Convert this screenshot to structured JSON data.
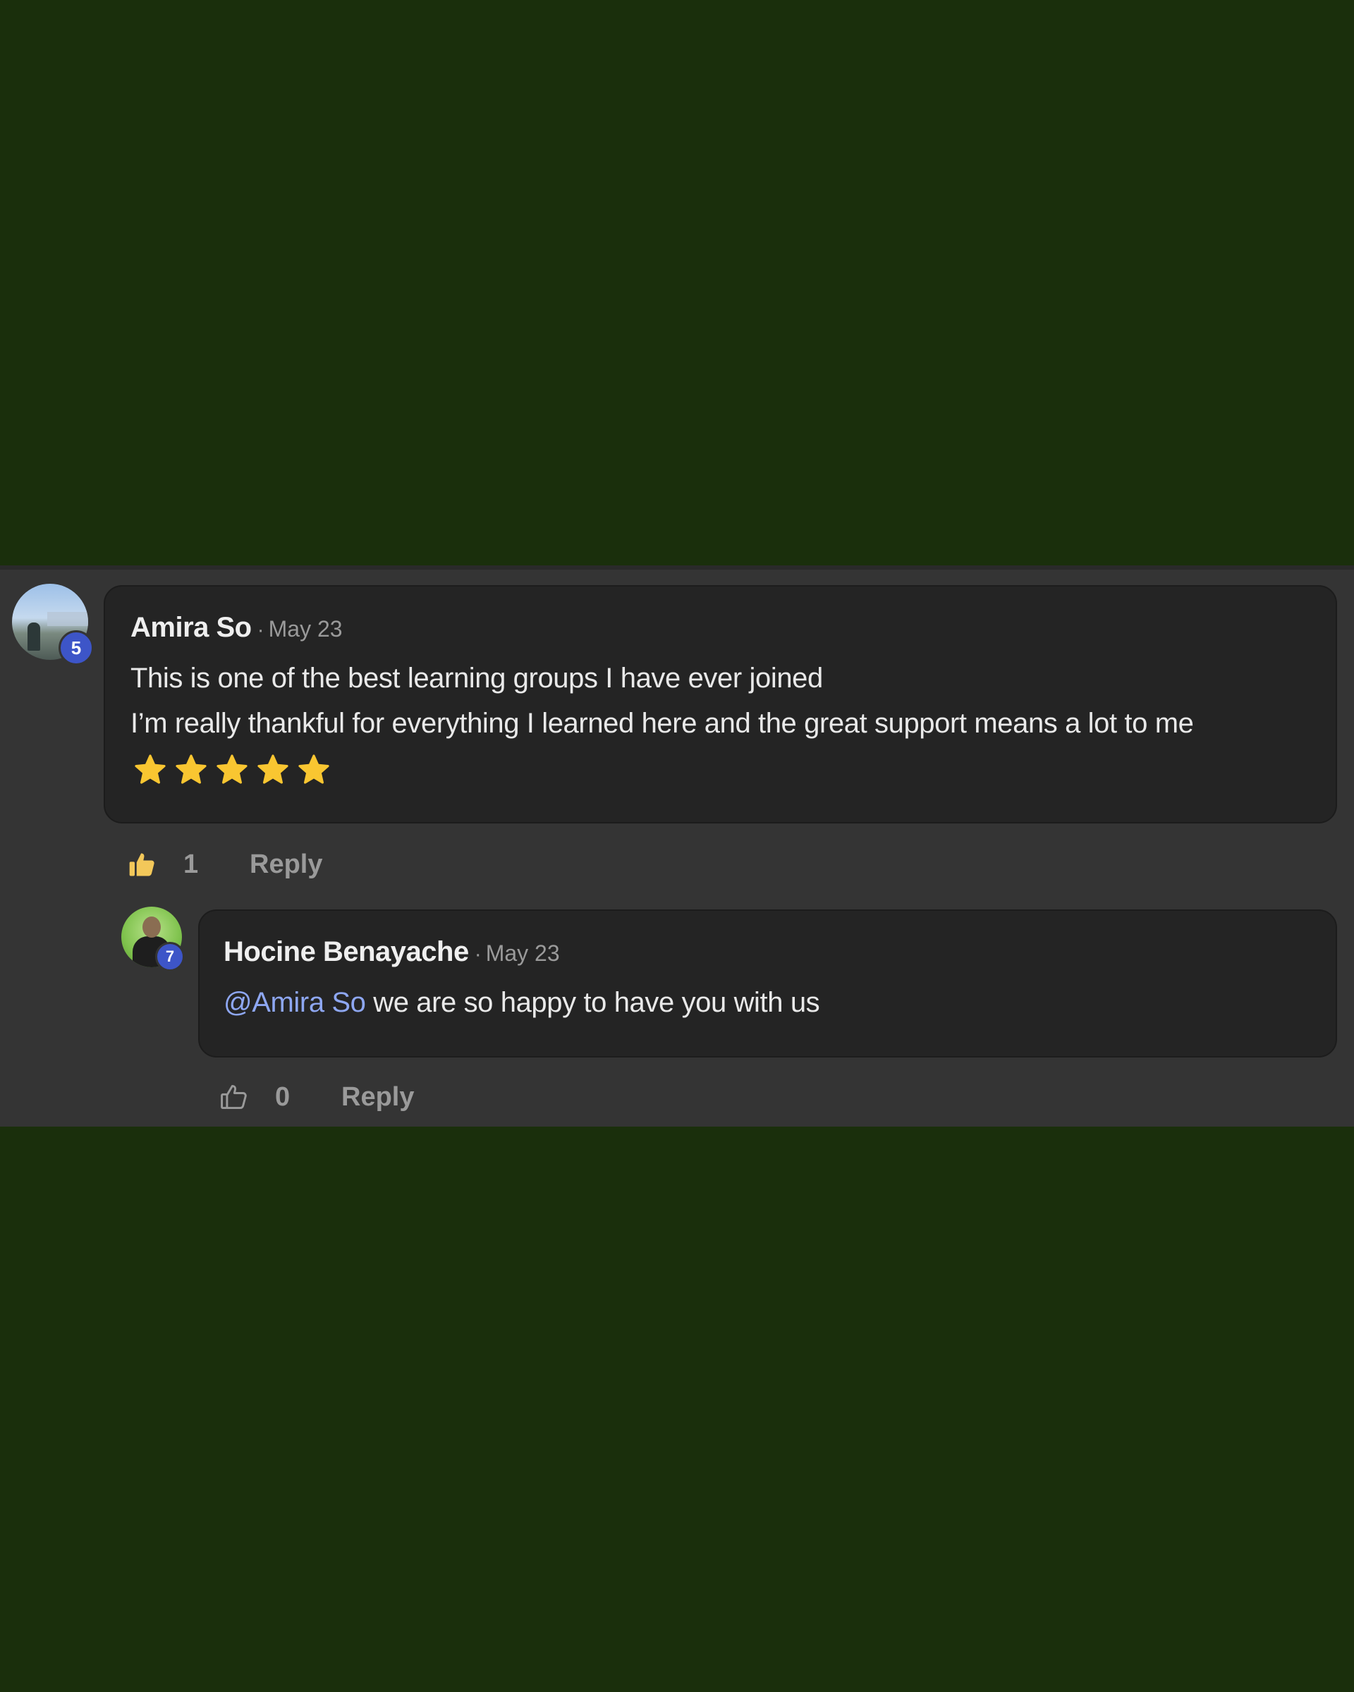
{
  "colors": {
    "page_background": "#1a2f0c",
    "panel_background": "#343434",
    "bubble_background": "#242424",
    "level_badge": "#3d55c8",
    "mention": "#8ea7f2",
    "star": "#f9c631",
    "liked_icon": "#f3c85a"
  },
  "comment": {
    "author": "Amira So",
    "separator": "·",
    "date": "May 23",
    "avatar_level": "5",
    "text_lines": [
      "This is one of the best learning groups I have ever joined",
      "I’m really thankful for everything I learned here and the great support means a lot to me"
    ],
    "stars_icon": "star-icon",
    "stars_rating": 5,
    "like_icon": "thumbs-up-filled-icon",
    "like_count": "1",
    "reply_label": "Reply"
  },
  "reply": {
    "author": "Hocine Benayache",
    "separator": "·",
    "date": "May 23",
    "avatar_level": "7",
    "mention": "@Amira So",
    "text": " we are so happy to have you with us",
    "like_icon": "thumbs-up-outline-icon",
    "like_count": "0",
    "reply_label": "Reply"
  }
}
